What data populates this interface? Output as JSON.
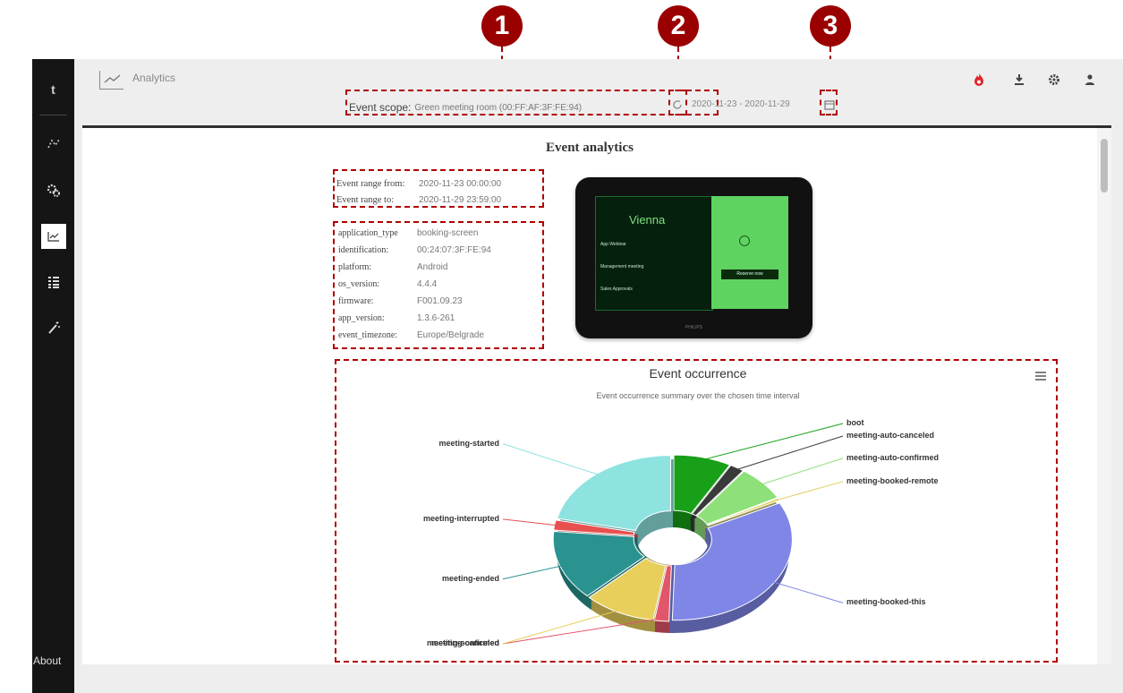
{
  "markers": [
    "1",
    "2",
    "3"
  ],
  "sidebar": {
    "logo": "t",
    "about": "About",
    "items": [
      "route-icon",
      "gears-icon",
      "analytics-icon",
      "list-icon",
      "wand-icon"
    ]
  },
  "appbar": {
    "title": "Analytics",
    "event_scope_label": "Event scope:",
    "event_scope_value": "Green meeting room (00:FF:AF:3F:FE:94)",
    "date_range": "2020-11-23 - 2020-11-29",
    "actions": [
      "fire-icon",
      "download-icon",
      "gear-icon",
      "user-icon"
    ]
  },
  "analytics": {
    "heading": "Event analytics",
    "range": [
      {
        "label": "Event range from:",
        "value": "2020-11-23 00:00:00"
      },
      {
        "label": "Event range to:",
        "value": "2020-11-29 23:59:00"
      }
    ],
    "device": [
      {
        "label": "application_type",
        "value": "booking-screen"
      },
      {
        "label": "identification:",
        "value": "00:24:07:3F:FE:94"
      },
      {
        "label": "platform:",
        "value": "Android"
      },
      {
        "label": "os_version:",
        "value": "4.4.4"
      },
      {
        "label": "firmware:",
        "value": "F001.09.23"
      },
      {
        "label": "app_version:",
        "value": "1.3.6-261"
      },
      {
        "label": "event_timezone:",
        "value": "Europe/Belgrade"
      }
    ],
    "device_screen": {
      "room": "Vienna",
      "rows": [
        "App Webinar",
        "Management meeting",
        "Sales Approvals"
      ],
      "button": "Reserve now",
      "footer": "PHILIPS"
    }
  },
  "chart_data": {
    "type": "pie",
    "title": "Event occurrence",
    "subtitle": "Event occurrence summary over the chosen time interval",
    "slices": [
      {
        "name": "boot",
        "value": 8,
        "color": "#18a018"
      },
      {
        "name": "meeting-auto-canceled",
        "value": 2,
        "color": "#3a3a3a"
      },
      {
        "name": "meeting-auto-confirmed",
        "value": 7,
        "color": "#8ee07a"
      },
      {
        "name": "meeting-booked-remote",
        "value": 0.5,
        "color": "#e0d060"
      },
      {
        "name": "meeting-booked-this",
        "value": 33,
        "color": "#7f86e6"
      },
      {
        "name": "meeting-canceled",
        "value": 2,
        "color": "#e2566a"
      },
      {
        "name": "meeting-confirmed",
        "value": 10,
        "color": "#e8cf5c"
      },
      {
        "name": "meeting-ended",
        "value": 14,
        "color": "#2a9390"
      },
      {
        "name": "meeting-interrupted",
        "value": 2,
        "color": "#e84f4f"
      },
      {
        "name": "meeting-started",
        "value": 21.5,
        "color": "#8ee3e0"
      }
    ]
  }
}
